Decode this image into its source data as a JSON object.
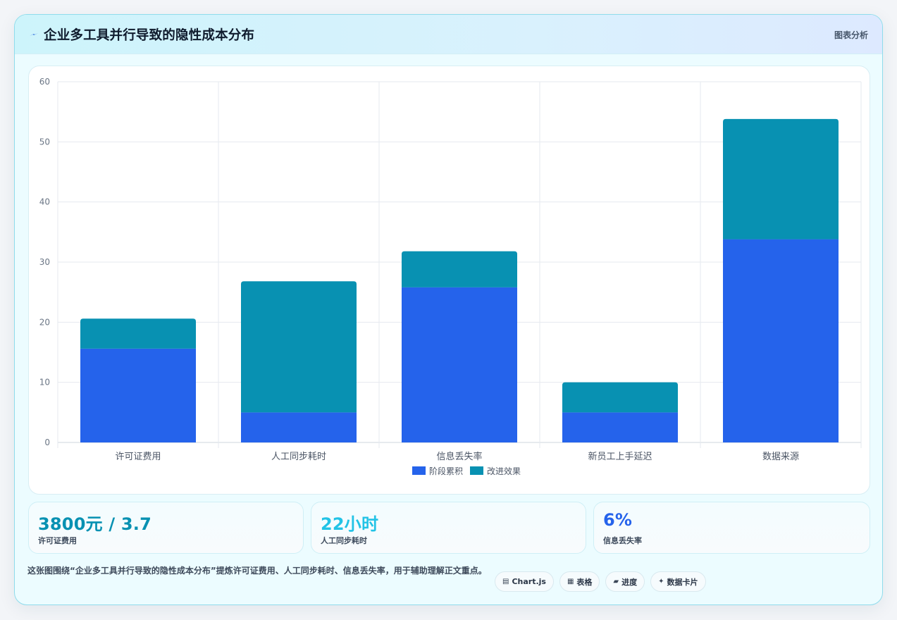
{
  "header": {
    "title": "企业多工具并行导致的隐性成本分布",
    "tag": "图表分析"
  },
  "colors": {
    "series_stage": "#2563eb",
    "series_improve": "#0891b2",
    "stat_1": "#0891b2",
    "stat_2": "#22c3e6",
    "stat_3": "#2563eb"
  },
  "chart_data": {
    "type": "bar",
    "stacked": true,
    "categories": [
      "许可证费用",
      "人工同步耗时",
      "信息丢失率",
      "新员工上手延迟",
      "数据来源"
    ],
    "series": [
      {
        "name": "阶段累积",
        "values": [
          15.6,
          5,
          25.8,
          5,
          33.8
        ]
      },
      {
        "name": "改进效果",
        "values": [
          5,
          21.8,
          6,
          5,
          20
        ]
      }
    ],
    "ylim": [
      0,
      60
    ],
    "yticks": [
      0,
      10,
      20,
      30,
      40,
      50,
      60
    ],
    "grid": true,
    "legend": "bottom"
  },
  "stats": [
    {
      "value": "3800元 / 3.7",
      "label": "许可证费用"
    },
    {
      "value": "22小时",
      "label": "人工同步耗时"
    },
    {
      "value": "6%",
      "label": "信息丢失率"
    }
  ],
  "footer": {
    "description": "这张图围绕“企业多工具并行导致的隐性成本分布”提炼许可证费用、人工同步耗时、信息丢失率，用于辅助理解正文重点。",
    "chips": [
      {
        "icon": "chart-icon",
        "label": "Chart.js"
      },
      {
        "icon": "table-icon",
        "label": "表格"
      },
      {
        "icon": "progress-icon",
        "label": "进度"
      },
      {
        "icon": "sparkle-icon",
        "label": "数据卡片"
      }
    ]
  }
}
